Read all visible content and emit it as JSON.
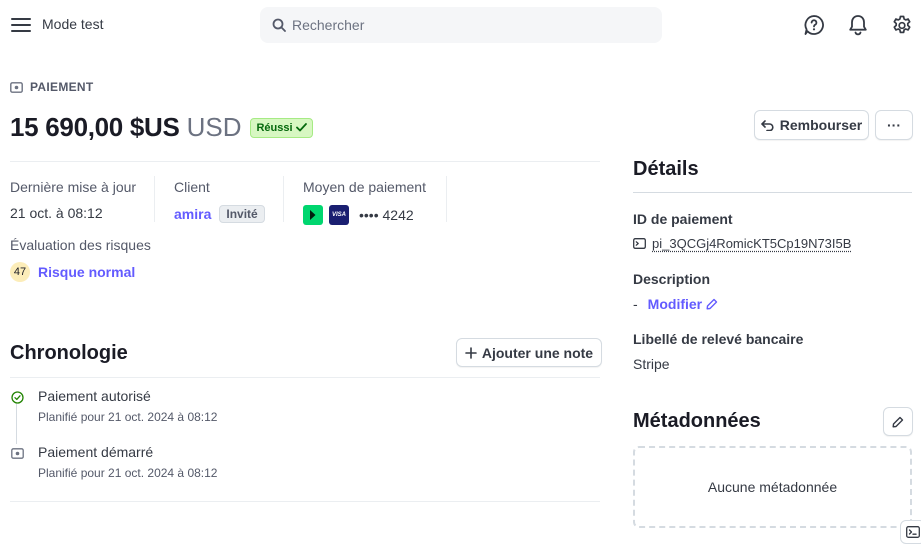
{
  "topbar": {
    "mode_label": "Mode test",
    "search_placeholder": "Rechercher"
  },
  "payment": {
    "kind_label": "PAIEMENT",
    "amount": "15 690,00 $US",
    "currency": "USD",
    "status": "Réussi",
    "refund_label": "Rembourser",
    "more_label": "···"
  },
  "summary": {
    "last_update_label": "Dernière mise à jour",
    "last_update_value": "21 oct. à 08:12",
    "client_label": "Client",
    "client_name": "amira",
    "client_badge": "Invité",
    "method_label": "Moyen de paiement",
    "card_brand": "VISA",
    "card_number": "•••• 4242",
    "risk_label": "Évaluation des risques",
    "risk_score": "47",
    "risk_level": "Risque normal"
  },
  "timeline": {
    "title": "Chronologie",
    "add_note_label": "Ajouter une note",
    "items": [
      {
        "title": "Paiement autorisé",
        "subtitle": "Planifié pour 21 oct. 2024 à 08:12"
      },
      {
        "title": "Paiement démarré",
        "subtitle": "Planifié pour 21 oct. 2024 à 08:12"
      }
    ]
  },
  "details": {
    "title": "Détails",
    "id_label": "ID de paiement",
    "id_value": "pi_3QCGj4RomicKT5Cp19N73I5B",
    "description_label": "Description",
    "description_value": "-",
    "edit_label": "Modifier",
    "bank_label": "Libellé de relevé bancaire",
    "bank_value": "Stripe"
  },
  "metadata": {
    "title": "Métadonnées",
    "empty_text": "Aucune métadonnée"
  },
  "colors": {
    "accent": "#635bff",
    "success_bg": "#d7f7c2",
    "success_text": "#05690d",
    "risk_bg": "#fcedb9",
    "link_logo": "#00d66f",
    "visa_logo": "#1a1f71"
  },
  "icons": {
    "menu": "menu-icon",
    "search": "search-icon",
    "help": "help-icon",
    "bell": "bell-icon",
    "gear": "gear-icon",
    "payment": "payment-icon",
    "check": "check-icon",
    "refund": "undo-icon",
    "plus": "plus-icon",
    "success": "check-circle-icon",
    "console": "terminal-icon",
    "pencil": "pencil-icon"
  }
}
